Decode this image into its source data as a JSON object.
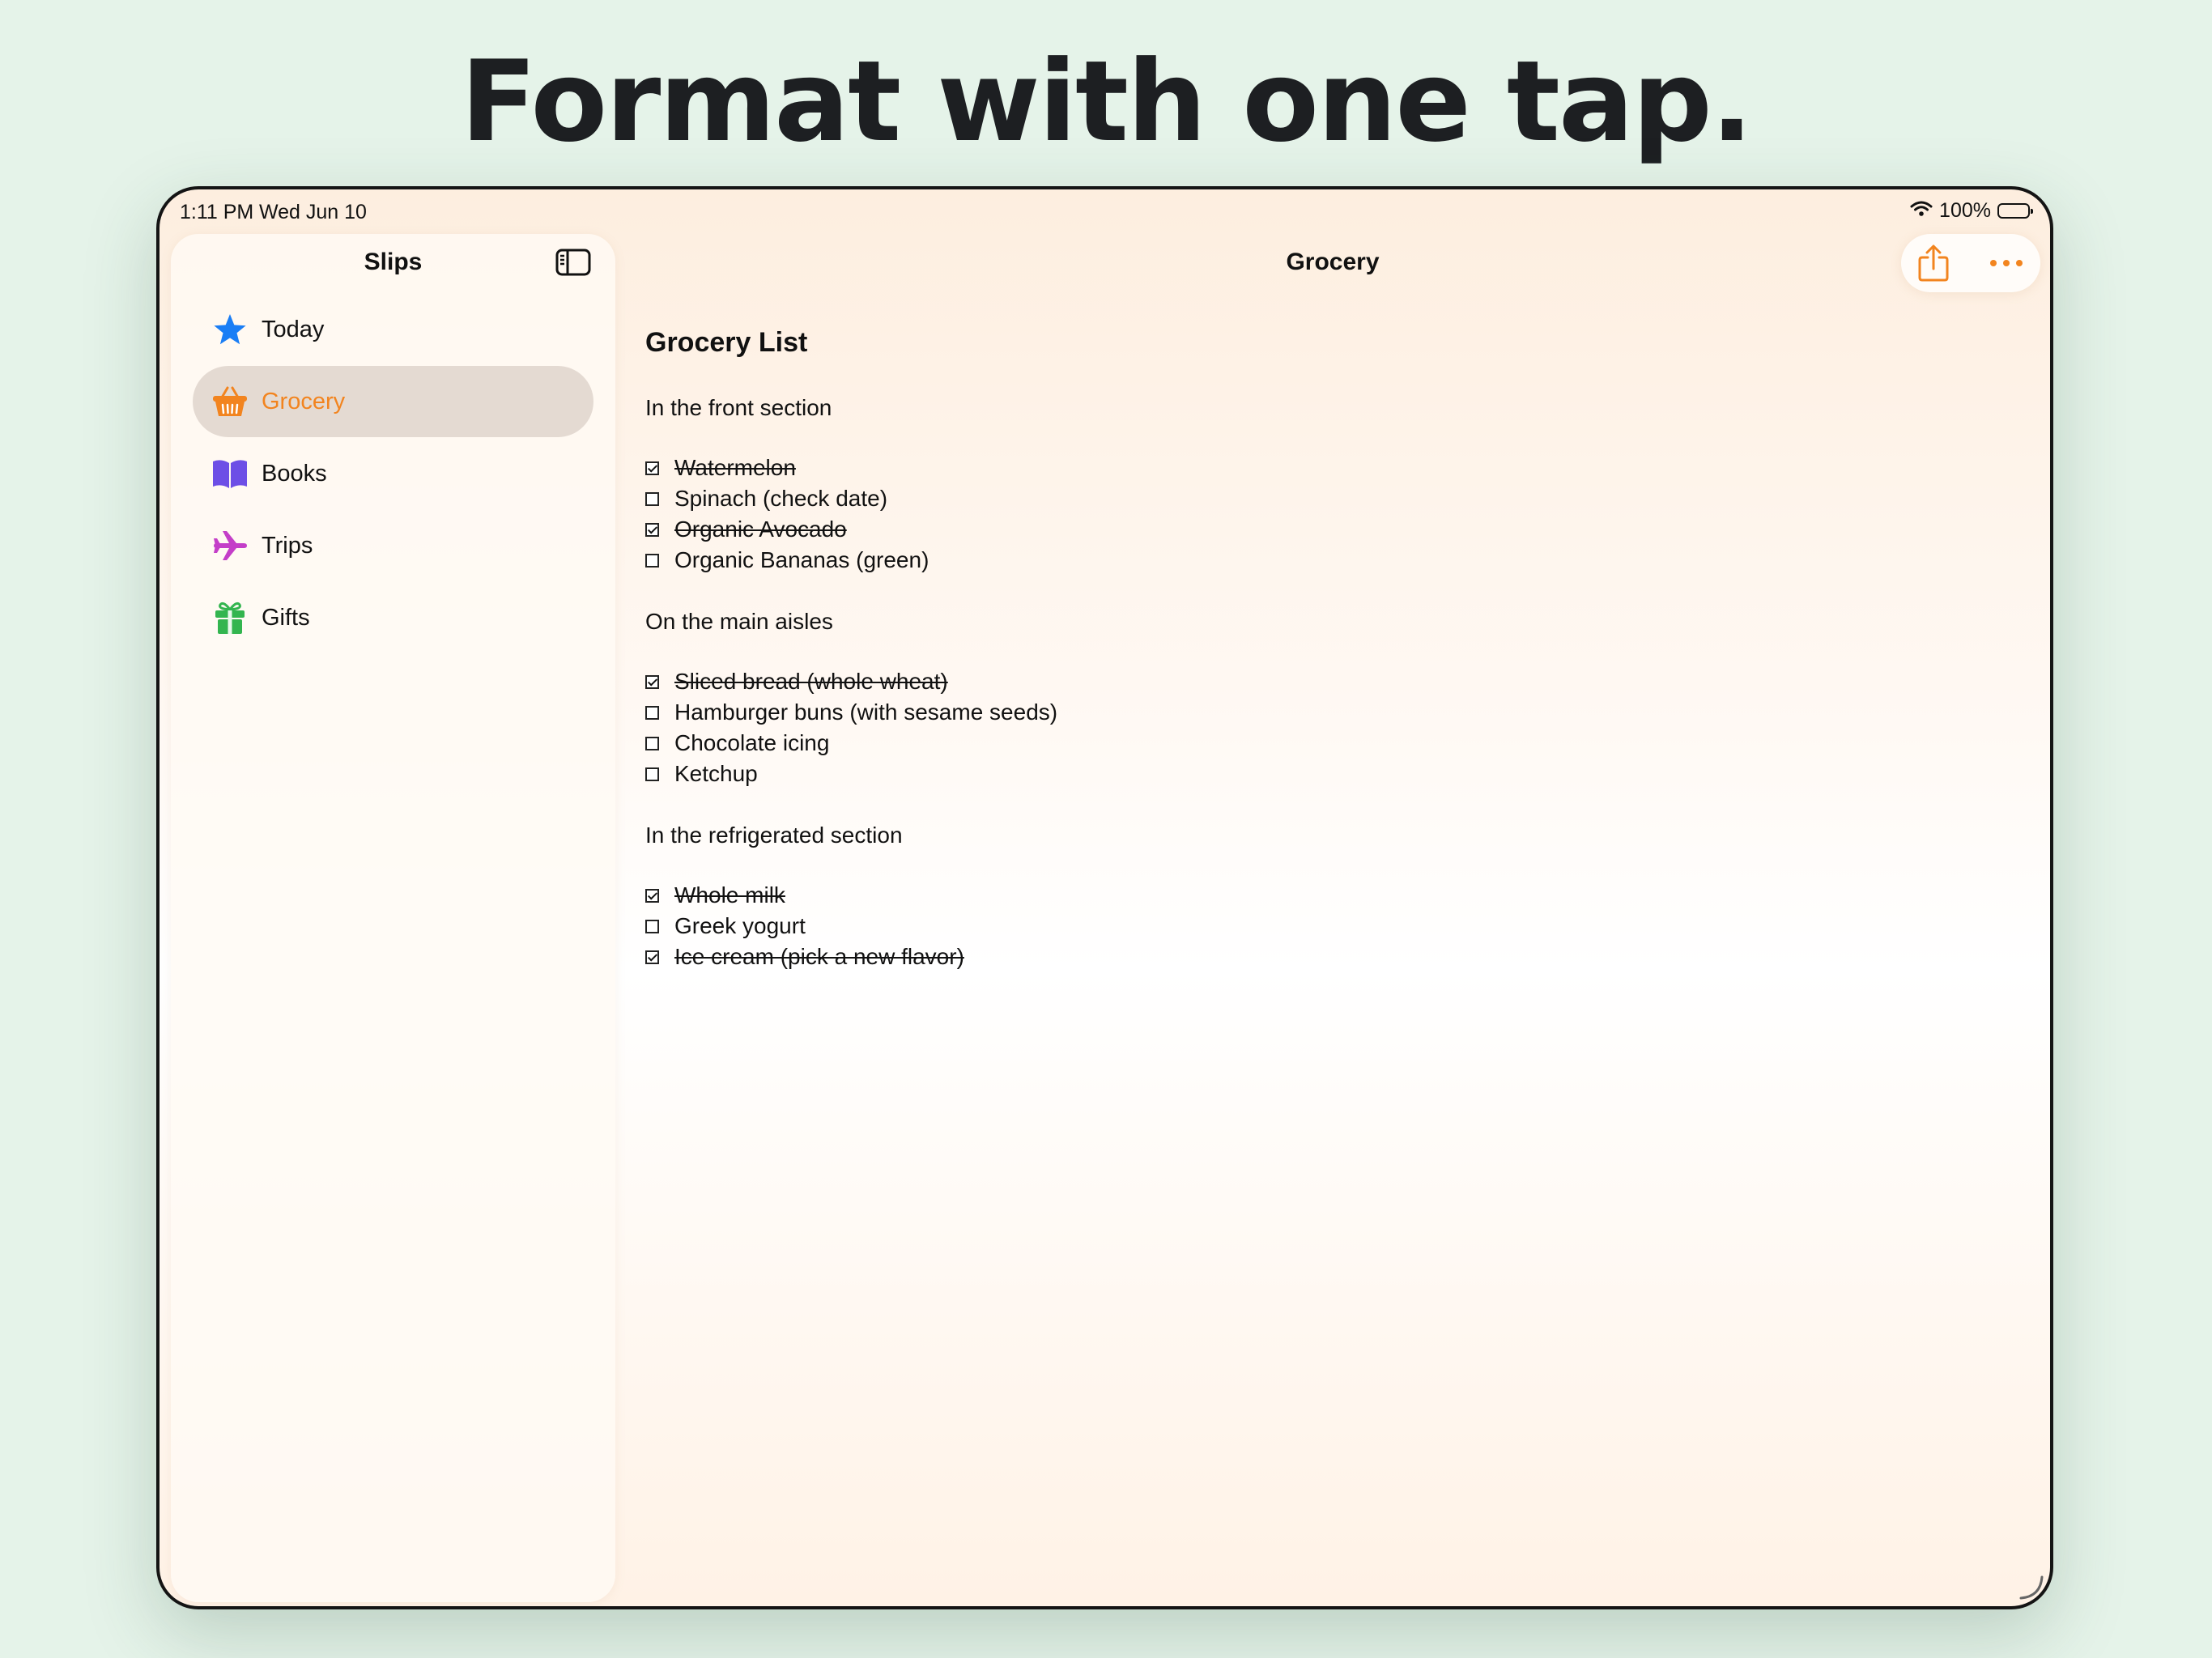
{
  "headline": "Format with one tap.",
  "status_bar": {
    "time": "1:11 PM",
    "date": "Wed Jun 10",
    "battery_text": "100%",
    "battery_level": 1.0,
    "icons": [
      "wifi-icon",
      "battery-icon"
    ]
  },
  "sidebar": {
    "title": "Slips",
    "toggle_icon": "sidebar-toggle-icon",
    "items": [
      {
        "label": "Today",
        "icon": "star-icon",
        "icon_color": "#1a7ef5",
        "selected": false
      },
      {
        "label": "Grocery",
        "icon": "basket-icon",
        "icon_color": "#f2841f",
        "selected": true
      },
      {
        "label": "Books",
        "icon": "book-icon",
        "icon_color": "#6d4fe6",
        "selected": false
      },
      {
        "label": "Trips",
        "icon": "airplane-icon",
        "icon_color": "#c43ec8",
        "selected": false
      },
      {
        "label": "Gifts",
        "icon": "gift-icon",
        "icon_color": "#33b54f",
        "selected": false
      }
    ]
  },
  "main": {
    "title": "Grocery",
    "toolbar": {
      "share_icon": "share-icon",
      "more_icon": "ellipsis-icon",
      "accent": "#f2841f"
    },
    "note": {
      "title": "Grocery List",
      "sections": [
        {
          "heading": "In the front section",
          "items": [
            {
              "text": "Watermelon",
              "checked": true
            },
            {
              "text": "Spinach (check date)",
              "checked": false
            },
            {
              "text": "Organic Avocado",
              "checked": true
            },
            {
              "text": "Organic Bananas (green)",
              "checked": false
            }
          ]
        },
        {
          "heading": "On the main aisles",
          "items": [
            {
              "text": "Sliced bread (whole wheat)",
              "checked": true
            },
            {
              "text": "Hamburger buns (with sesame seeds)",
              "checked": false
            },
            {
              "text": "Chocolate icing",
              "checked": false
            },
            {
              "text": "Ketchup",
              "checked": false
            }
          ]
        },
        {
          "heading": "In the refrigerated section",
          "items": [
            {
              "text": "Whole milk",
              "checked": true
            },
            {
              "text": "Greek yogurt",
              "checked": false
            },
            {
              "text": "Ice cream (pick a new flavor)",
              "checked": true
            }
          ]
        }
      ]
    }
  }
}
